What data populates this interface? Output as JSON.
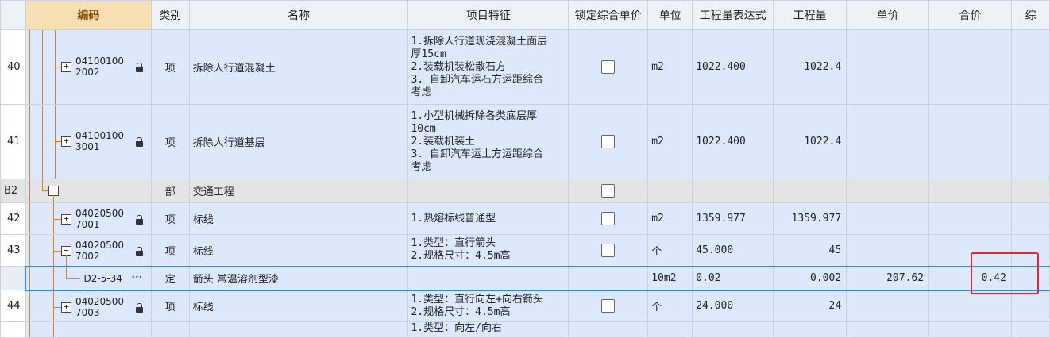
{
  "headers": {
    "code": "编码",
    "category": "类别",
    "name": "名称",
    "features": "项目特征",
    "lock_price": "锁定综合单价",
    "unit": "单位",
    "expr": "工程量表达式",
    "qty": "工程量",
    "price": "单价",
    "total": "合价",
    "extra": "综"
  },
  "rows": [
    {
      "num": "40",
      "code1": "04100100",
      "code2": "2002",
      "cat": "项",
      "name": "拆除人行道混凝土",
      "f1": "1.拆除人行道现浇混凝土面层",
      "f2": "厚15cm",
      "f3": "2.装载机装松散石方",
      "f4": "3. 自卸汽车运石方运距综合",
      "f5": "考虑",
      "unit": "m2",
      "expr": "1022.400",
      "qty": "1022.4",
      "price": "",
      "total": ""
    },
    {
      "num": "41",
      "code1": "04100100",
      "code2": "3001",
      "cat": "项",
      "name": "拆除人行道基层",
      "f1": "1.小型机械拆除各类底层厚",
      "f2": "10cm",
      "f3": "2.装载机装土",
      "f4": "3. 自卸汽车运土方运距综合",
      "f5": "考虑",
      "unit": "m2",
      "expr": "1022.400",
      "qty": "1022.4",
      "price": "",
      "total": ""
    },
    {
      "num": "B2",
      "cat": "部",
      "name": "交通工程"
    },
    {
      "num": "42",
      "code1": "04020500",
      "code2": "7001",
      "cat": "项",
      "name": "标线",
      "f1": "1.热熔标线普通型",
      "unit": "m2",
      "expr": "1359.977",
      "qty": "1359.977"
    },
    {
      "num": "43",
      "code1": "04020500",
      "code2": "7002",
      "cat": "项",
      "name": "标线",
      "f1": "1.类型：直行箭头",
      "f2": "2.规格尺寸：4.5m高",
      "unit": "个",
      "expr": "45.000",
      "qty": "45"
    },
    {
      "num": "",
      "code1": "D2-5-34",
      "cat": "定",
      "name": "箭头 常温溶剂型漆",
      "unit": "10m2",
      "expr": "0.02",
      "qty": "0.002",
      "price": "207.62",
      "total": "0.42"
    },
    {
      "num": "44",
      "code1": "04020500",
      "code2": "7003",
      "cat": "项",
      "name": "标线",
      "f1": "1.类型：直行向左+向右箭头",
      "f2": "2.规格尺寸：4.5m高",
      "unit": "个",
      "expr": "24.000",
      "qty": "24"
    },
    {
      "f1": "1.类型：向左/向右"
    }
  ],
  "icons": {
    "expand": "plus-box-icon",
    "collapse": "minus-box-icon",
    "lock": "lock-icon",
    "more": "ellipsis-icon"
  },
  "colors": {
    "tree_line": "#e07b2a",
    "highlight_box": "#e0262a",
    "selection": "#3b86d8",
    "row_bg": "#dde8fb"
  }
}
